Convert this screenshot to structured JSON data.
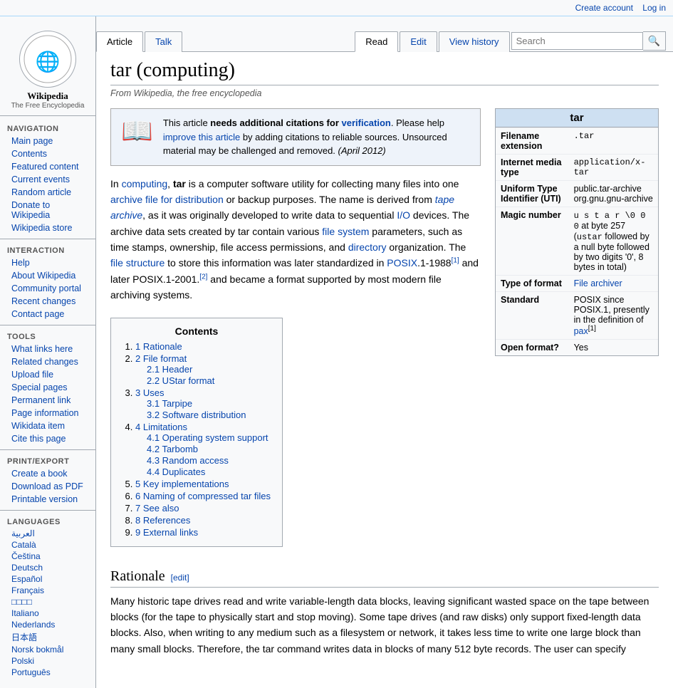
{
  "topbar": {
    "create_account": "Create account",
    "log_in": "Log in"
  },
  "sidebar": {
    "logo_symbol": "🌐",
    "logo_text": "Wikipedia",
    "logo_sub": "The Free Encyclopedia",
    "navigation": {
      "title": "Navigation",
      "items": [
        {
          "id": "main-page",
          "label": "Main page"
        },
        {
          "id": "contents",
          "label": "Contents"
        },
        {
          "id": "featured-content",
          "label": "Featured content"
        },
        {
          "id": "current-events",
          "label": "Current events"
        },
        {
          "id": "random-article",
          "label": "Random article"
        },
        {
          "id": "donate",
          "label": "Donate to Wikipedia"
        },
        {
          "id": "wikipedia-store",
          "label": "Wikipedia store"
        }
      ]
    },
    "interaction": {
      "title": "Interaction",
      "items": [
        {
          "id": "help",
          "label": "Help"
        },
        {
          "id": "about",
          "label": "About Wikipedia"
        },
        {
          "id": "community-portal",
          "label": "Community portal"
        },
        {
          "id": "recent-changes",
          "label": "Recent changes"
        },
        {
          "id": "contact",
          "label": "Contact page"
        }
      ]
    },
    "tools": {
      "title": "Tools",
      "items": [
        {
          "id": "what-links-here",
          "label": "What links here"
        },
        {
          "id": "related-changes",
          "label": "Related changes"
        },
        {
          "id": "upload-file",
          "label": "Upload file"
        },
        {
          "id": "special-pages",
          "label": "Special pages"
        },
        {
          "id": "permanent-link",
          "label": "Permanent link"
        },
        {
          "id": "page-information",
          "label": "Page information"
        },
        {
          "id": "wikidata-item",
          "label": "Wikidata item"
        },
        {
          "id": "cite-page",
          "label": "Cite this page"
        }
      ]
    },
    "print_export": {
      "title": "Print/export",
      "items": [
        {
          "id": "create-book",
          "label": "Create a book"
        },
        {
          "id": "download-pdf",
          "label": "Download as PDF"
        },
        {
          "id": "printable-version",
          "label": "Printable version"
        }
      ]
    },
    "languages": {
      "title": "Languages",
      "items": [
        {
          "id": "lang-arabic",
          "label": "العربية"
        },
        {
          "id": "lang-catala",
          "label": "Català"
        },
        {
          "id": "lang-cestina",
          "label": "Čeština"
        },
        {
          "id": "lang-deutsch",
          "label": "Deutsch"
        },
        {
          "id": "lang-espanol",
          "label": "Español"
        },
        {
          "id": "lang-francais",
          "label": "Français"
        },
        {
          "id": "lang-cjk",
          "label": "□□□□"
        },
        {
          "id": "lang-italiano",
          "label": "Italiano"
        },
        {
          "id": "lang-nederlands",
          "label": "Nederlands"
        },
        {
          "id": "lang-japanese",
          "label": "日本語"
        },
        {
          "id": "lang-norwegian",
          "label": "Norsk bokmål"
        },
        {
          "id": "lang-polski",
          "label": "Polski"
        },
        {
          "id": "lang-portuguese",
          "label": "Português"
        }
      ]
    }
  },
  "tabs": {
    "article": "Article",
    "talk": "Talk",
    "read": "Read",
    "edit": "Edit",
    "view_history": "View history"
  },
  "search": {
    "placeholder": "Search"
  },
  "article": {
    "title": "tar (computing)",
    "from_line": "From Wikipedia, the free encyclopedia",
    "citation_box": {
      "text_before": "This article ",
      "needs_text": "needs additional citations for",
      "verification": "verification",
      "text_after": ". Please help ",
      "improve_link": "improve this article",
      "by_adding": " by adding citations to reliable sources",
      "unsourced": ". Unsourced material may be challenged and removed.",
      "date": "(April 2012)"
    },
    "infobox": {
      "title": "tar",
      "rows": [
        {
          "label": "Filename extension",
          "value": ".tar",
          "mono": true
        },
        {
          "label": "Internet media type",
          "value": "application/x-tar",
          "mono": true
        },
        {
          "label": "Uniform Type Identifier (UTI)",
          "value": "public.tar-archive org.gnu.gnu-archive",
          "mono": false
        },
        {
          "label": "Magic number",
          "value": "u s t a r \\0 0 0 at byte 257 (ustar followed by a null byte followed by two digits '0', 8 bytes in total)",
          "mono": false
        },
        {
          "label": "Type of format",
          "value": "File archiver",
          "link": true
        },
        {
          "label": "Standard",
          "value": "POSIX since POSIX.1, presently in the definition of pax[1]",
          "mono": false
        },
        {
          "label": "Open format?",
          "value": "Yes",
          "mono": false
        }
      ]
    },
    "intro_paragraphs": [
      "In computing, tar is a computer software utility for collecting many files into one archive file for distribution or backup purposes. The name is derived from tape archive, as it was originally developed to write data to sequential I/O devices. The archive data sets created by tar contain various file system parameters, such as time stamps, ownership, file access permissions, and directory organization. The file structure to store this information was later standardized in POSIX.1-1988[1] and later POSIX.1-2001.[2] and became a format supported by most modern file archiving systems."
    ],
    "toc": {
      "title": "Contents",
      "items": [
        {
          "num": "1",
          "label": "Rationale",
          "sub": []
        },
        {
          "num": "2",
          "label": "File format",
          "sub": [
            {
              "num": "2.1",
              "label": "Header"
            },
            {
              "num": "2.2",
              "label": "UStar format"
            }
          ]
        },
        {
          "num": "3",
          "label": "Uses",
          "sub": [
            {
              "num": "3.1",
              "label": "Tarpipe"
            },
            {
              "num": "3.2",
              "label": "Software distribution"
            }
          ]
        },
        {
          "num": "4",
          "label": "Limitations",
          "sub": [
            {
              "num": "4.1",
              "label": "Operating system support"
            },
            {
              "num": "4.2",
              "label": "Tarbomb"
            },
            {
              "num": "4.3",
              "label": "Random access"
            },
            {
              "num": "4.4",
              "label": "Duplicates"
            }
          ]
        },
        {
          "num": "5",
          "label": "Key implementations",
          "sub": []
        },
        {
          "num": "6",
          "label": "Naming of compressed tar files",
          "sub": []
        },
        {
          "num": "7",
          "label": "See also",
          "sub": []
        },
        {
          "num": "8",
          "label": "References",
          "sub": []
        },
        {
          "num": "9",
          "label": "External links",
          "sub": []
        }
      ]
    },
    "rationale": {
      "heading": "Rationale",
      "edit_label": "[edit]",
      "text": "Many historic tape drives read and write variable-length data blocks, leaving significant wasted space on the tape between blocks (for the tape to physically start and stop moving). Some tape drives (and raw disks) only support fixed-length data blocks. Also, when writing to any medium such as a filesystem or network, it takes less time to write one large block than many small blocks. Therefore, the tar command writes data in blocks of many 512 byte records. The user can specify"
    }
  }
}
